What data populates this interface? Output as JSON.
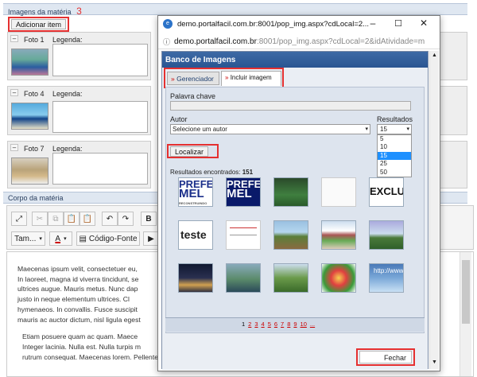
{
  "editor": {
    "images_section_title": "Imagens da matéria",
    "step_number": "3",
    "add_item_label": "Adicionar item",
    "photos": [
      {
        "label": "Foto 1",
        "caption_label": "Legenda:"
      },
      {
        "label": "Foto 4",
        "caption_label": "Legenda:"
      },
      {
        "label": "Foto 7",
        "caption_label": "Legenda:"
      }
    ],
    "body_section_title": "Corpo da matéria",
    "font_size_label": "Tam...",
    "font_color_label": "A",
    "source_code_label": "Código-Fonte",
    "bold_label": "B",
    "paragraph1_lines": [
      "Maecenas ipsum velit, consectetuer eu,",
      "In laoreet, magna id viverra tincidunt, se",
      "ultrices augue. Mauris metus. Nunc dap",
      "justo in neque elementum ultrices. Cl",
      "hymenaeos. In convallis. Fusce suscipit",
      "mauris ac auctor dictum, nisl ligula egest"
    ],
    "paragraph2_lines": [
      "Etiam posuere quam ac quam. Maece",
      "Integer lacinia. Nulla est. Nulla turpis m",
      "rutrum consequat. Maecenas lorem. Pellentesque pretium lectus id turpis. Etiam sapien elit, consequat eget, tristique non,"
    ]
  },
  "popup": {
    "window_title": "demo.portalfacil.com.br:8001/pop_img.aspx?cdLocal=2...",
    "url_domain": "demo.portalfacil.com.br",
    "url_rest": ":8001/pop_img.aspx?cdLocal=2&idAtividade=m",
    "header_title": "Banco de Imagens",
    "tabs": {
      "manager": "Gerenciador",
      "include": "Incluir imagem"
    },
    "keyword_label": "Palavra chave",
    "keyword_value": "",
    "author_label": "Autor",
    "author_selected": "Selecione um autor",
    "results_label": "Resultados",
    "results_selected": "15",
    "results_options": [
      "5",
      "10",
      "15",
      "25",
      "50"
    ],
    "search_button": "Localizar",
    "results_found_label": "Resultados encontrados:",
    "results_found_count": "151",
    "pages": [
      "1",
      "2",
      "3",
      "4",
      "5",
      "6",
      "7",
      "8",
      "9",
      "10",
      "..."
    ],
    "close_button": "Fechar",
    "thumb_texts": {
      "prefeitura": "PREFEI",
      "mel": "MEL",
      "reconstruindo": "RECONSTRUINDO",
      "exclui": "EXCLUI",
      "teste": "teste",
      "http": "http://www."
    }
  },
  "colors": {
    "accent": "#1f5fb0",
    "highlight": "#e53030",
    "section_bg": "#dfe7f1"
  }
}
